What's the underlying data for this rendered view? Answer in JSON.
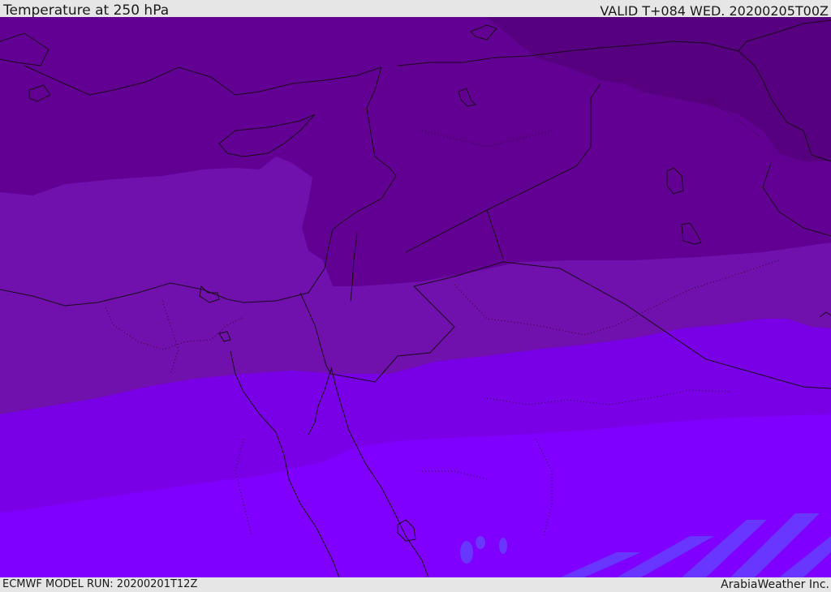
{
  "header": {
    "title": "Temperature at 250 hPa",
    "valid": "VALID T+084 WED. 20200205T00Z"
  },
  "footer": {
    "model_run": "ECMWF MODEL RUN: 20200201T12Z",
    "credit": "ArabiaWeather Inc."
  },
  "map": {
    "colors": {
      "band_coldest": "#560080",
      "band_cold": "#630094",
      "band_mid": "#7010ad",
      "band_warm_mid": "#7200c8",
      "band_warm": "#7900e6",
      "band_warmest": "#7f00ff",
      "band_bluish": "#6440ff",
      "outline": "#1a0a1a"
    }
  }
}
